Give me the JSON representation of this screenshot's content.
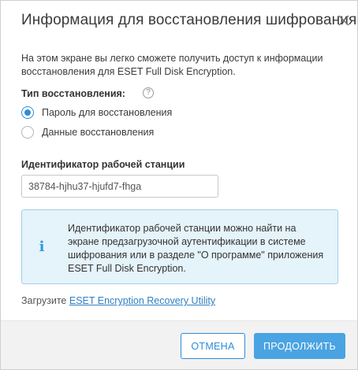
{
  "dialog": {
    "title": "Информация для восстановления шифрования",
    "description": "На этом экране вы легко сможете получить доступ к информации восстановления для ESET Full Disk Encryption."
  },
  "recovery_type": {
    "label": "Тип восстановления:",
    "help_icon": "?",
    "options": [
      {
        "label": "Пароль для восстановления",
        "checked": true
      },
      {
        "label": "Данные восстановления",
        "checked": false
      }
    ]
  },
  "workstation": {
    "label": "Идентификатор рабочей станции",
    "value": "38784-hjhu37-hjufd7-fhga"
  },
  "info": {
    "icon": "i",
    "text": "Идентификатор рабочей станции можно найти на экране предзагрузочной аутентификации в системе шифрования или в разделе \"О программе\" приложения ESET Full Disk Encryption."
  },
  "download": {
    "prefix": "Загрузите",
    "link_text": "ESET Encryption Recovery Utility"
  },
  "buttons": {
    "cancel": "ОТМЕНА",
    "continue": "ПРОДОЛЖИТЬ"
  },
  "colors": {
    "accent": "#2f8cd8",
    "primary_button": "#4aa3e2",
    "info_bg": "#e5f3fa",
    "info_border": "#9ed0ea"
  }
}
